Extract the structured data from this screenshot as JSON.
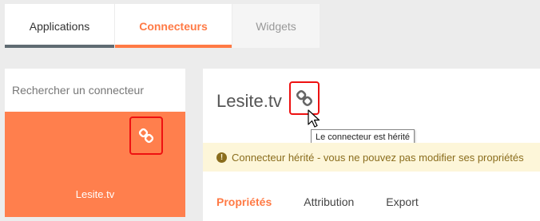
{
  "top_tabs": [
    {
      "label": "Applications"
    },
    {
      "label": "Connecteurs"
    },
    {
      "label": "Widgets"
    }
  ],
  "sidebar": {
    "search_placeholder": "Rechercher un connecteur",
    "selected_connector": {
      "label": "Lesite.tv",
      "icon": "link-icon"
    }
  },
  "main": {
    "title": "Lesite.tv",
    "tooltip": "Le connecteur est hérité",
    "warning": "Connecteur hérité - vous ne pouvez pas modifier ses propriétés",
    "tabs": [
      {
        "label": "Propriétés"
      },
      {
        "label": "Attribution"
      },
      {
        "label": "Export"
      }
    ]
  },
  "colors": {
    "accent": "#ff7a45",
    "highlight_border": "#e11111",
    "warning_bg": "#fdf6d9",
    "warning_text": "#8a6d1d"
  }
}
